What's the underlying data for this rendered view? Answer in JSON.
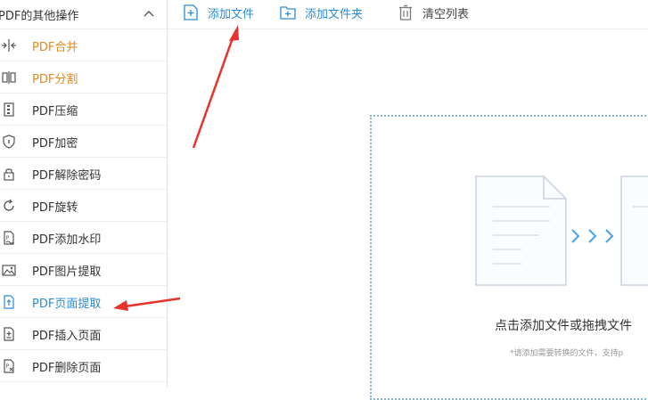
{
  "sidebar": {
    "header_title": "PDF的其他操作",
    "items": [
      {
        "label": "PDF合并",
        "icon": "merge-icon"
      },
      {
        "label": "PDF分割",
        "icon": "split-icon"
      },
      {
        "label": "PDF压缩",
        "icon": "compress-icon"
      },
      {
        "label": "PDF加密",
        "icon": "shield-icon"
      },
      {
        "label": "PDF解除密码",
        "icon": "unlock-icon"
      },
      {
        "label": "PDF旋转",
        "icon": "rotate-icon"
      },
      {
        "label": "PDF添加水印",
        "icon": "watermark-icon"
      },
      {
        "label": "PDF图片提取",
        "icon": "image-icon"
      },
      {
        "label": "PDF页面提取",
        "icon": "page-extract-icon"
      },
      {
        "label": "PDF插入页面",
        "icon": "insert-page-icon"
      },
      {
        "label": "PDF删除页面",
        "icon": "delete-page-icon"
      }
    ]
  },
  "toolbar": {
    "add_file": "添加文件",
    "add_folder": "添加文件夹",
    "clear_list": "清空列表"
  },
  "dropzone": {
    "main_text": "点击添加文件或拖拽文件",
    "hint_text": "*请添加需要转换的文件，支持p"
  },
  "colors": {
    "accent_blue": "#2a8bd8",
    "accent_orange": "#e08a1e",
    "annotation_red": "#e8322b"
  }
}
